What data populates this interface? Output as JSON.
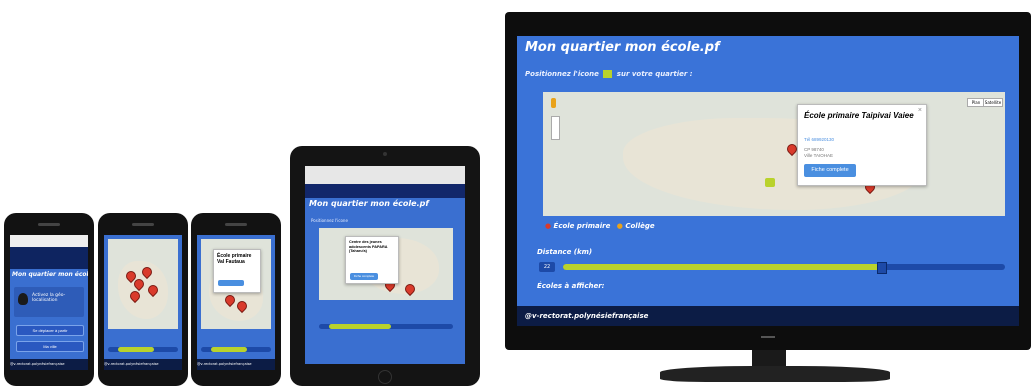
{
  "site": {
    "title": "Mon quartier mon école.pf",
    "instruction": "Positionnez l'icone",
    "instruction_tail": "sur votre quartier :",
    "footer": "@v-rectorat.polynésiefrançaise"
  },
  "tv": {
    "popup": {
      "title": "École primaire Taipivai Vaiee",
      "line1": "Tél 689920130",
      "line2": "CP 98740",
      "line3": "Ville TAIOHAE",
      "button": "Fiche complete"
    },
    "map_type": [
      "Plan",
      "Satellite"
    ],
    "legend": {
      "primary": "École primaire",
      "college": "Collège"
    },
    "distance_label": "Distance (km)",
    "distance_value": "22",
    "distance_fraction": 0.72,
    "schools_label": "Écoles à afficher:"
  },
  "tablet": {
    "popup_title": "Centre des jeunes adolescents PAPARA (Taharu'a)",
    "popup_button": "Fiche complete"
  },
  "phone1": {
    "locate_text": "Activez la géo-localisation",
    "btn1": "Se déplacer à partir",
    "btn2": "Ma ville"
  },
  "phone3": {
    "popup_title": "École primaire Val Fautaua"
  },
  "colors": {
    "bg_blue": "#3a6fd0",
    "accent_green": "#b9d22c",
    "pin_red": "#d93a2b",
    "bezel": "#111111"
  }
}
